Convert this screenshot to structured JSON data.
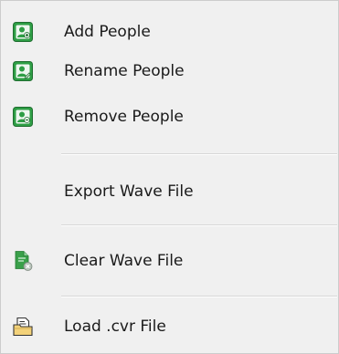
{
  "menu": {
    "items": [
      {
        "label": "Add People",
        "icon": "add-person-icon"
      },
      {
        "label": "Rename People",
        "icon": "rename-person-icon"
      },
      {
        "label": "Remove People",
        "icon": "remove-person-icon"
      },
      {
        "label": "Export Wave File",
        "icon": ""
      },
      {
        "label": "Clear Wave File",
        "icon": "clear-file-icon"
      },
      {
        "label": "Load .cvr File",
        "icon": "load-file-icon"
      }
    ]
  },
  "colors": {
    "person_icon_fill": "#2e9e45",
    "file_icon_green": "#3aa04a",
    "folder_icon_yellow": "#f3d27a",
    "menu_background": "#f0f0f0",
    "separator": "#d7d7d7"
  }
}
